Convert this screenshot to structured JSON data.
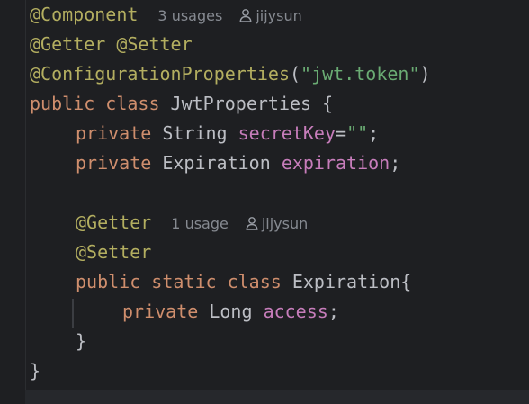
{
  "code": {
    "line1": {
      "annotation": "@Component",
      "usages": "3 usages",
      "author": "jijysun"
    },
    "line2": {
      "getter": "@Getter",
      "setter": "@Setter"
    },
    "line3": {
      "annotation": "@ConfigurationProperties",
      "open_paren": "(",
      "string": "\"jwt.token\"",
      "close_paren": ")"
    },
    "line4": {
      "keywords": "public class",
      "class_name": "JwtProperties",
      "brace": "{"
    },
    "line5": {
      "keyword": "private",
      "type": "String",
      "field": "secretKey",
      "equals": "=",
      "string": "\"\"",
      "semicolon": ";"
    },
    "line6": {
      "keyword": "private",
      "type": "Expiration",
      "field": "expiration",
      "semicolon": ";"
    },
    "line8": {
      "annotation": "@Getter",
      "usages": "1 usage",
      "author": "jijysun"
    },
    "line9": {
      "annotation": "@Setter"
    },
    "line10": {
      "keywords": "public static class",
      "class_name": "Expiration",
      "brace": "{"
    },
    "line11": {
      "keyword": "private",
      "type": "Long",
      "field": "access",
      "semicolon": ";"
    },
    "line12": {
      "brace": "}"
    },
    "line13": {
      "brace": "}"
    }
  },
  "icons": {
    "author": "user-icon"
  },
  "colors": {
    "background": "#1e1f22",
    "annotation": "#b3ae60",
    "keyword": "#cf8e6d",
    "field": "#c77dbb",
    "string": "#6aab73",
    "text": "#bcbec4",
    "hint": "#868a91"
  }
}
